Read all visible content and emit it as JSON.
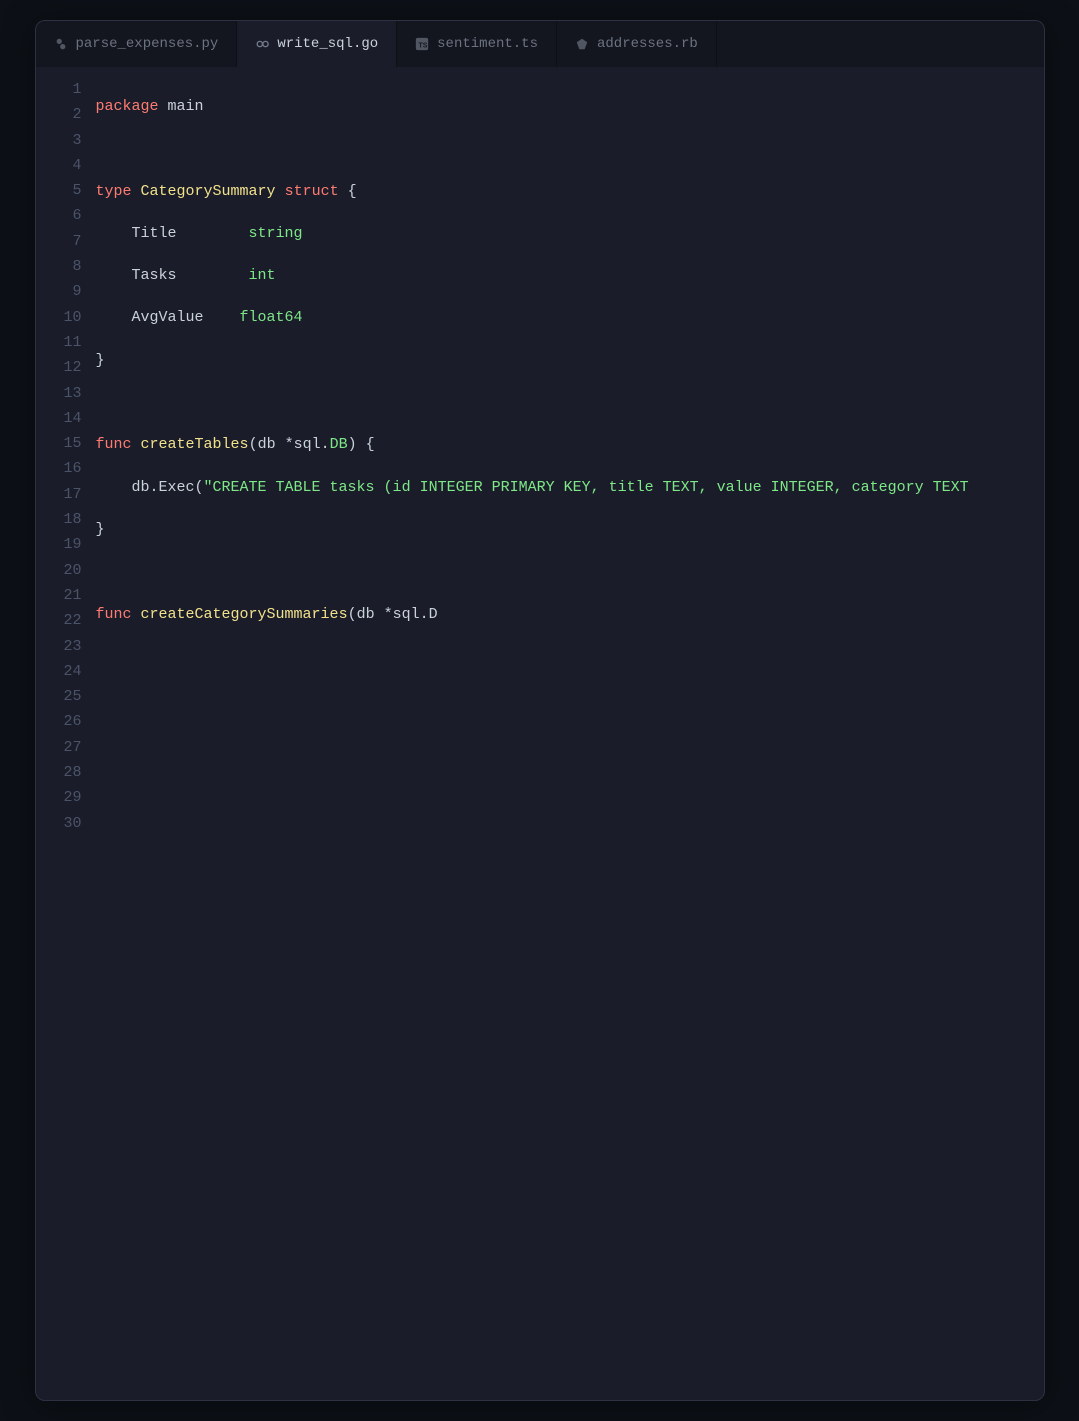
{
  "tabs": [
    {
      "icon": "python-icon",
      "label": "parse_expenses.py",
      "active": false
    },
    {
      "icon": "go-icon",
      "label": "write_sql.go",
      "active": true
    },
    {
      "icon": "ts-icon",
      "label": "sentiment.ts",
      "active": false
    },
    {
      "icon": "ruby-icon",
      "label": "addresses.rb",
      "active": false
    }
  ],
  "gutter": {
    "start": 1,
    "end": 30
  },
  "code": {
    "l1_kw": "package",
    "l1_id": "main",
    "l3_kw": "type",
    "l3_name": "CategorySummary",
    "l3_struct": "struct",
    "l3_brace": "{",
    "l4_field": "    Title        ",
    "l4_type": "string",
    "l5_field": "    Tasks        ",
    "l5_type": "int",
    "l6_field": "    AvgValue    ",
    "l6_type": "float64",
    "l7_brace": "}",
    "l9_kw": "func",
    "l9_name": "createTables",
    "l9_paren": "(db *sql.",
    "l9_type": "DB",
    "l9_close": ") {",
    "l10_call": "    db.Exec(",
    "l10_str": "\"CREATE TABLE tasks (id INTEGER PRIMARY KEY, title TEXT, value INTEGER, category TEXT",
    "l11_brace": "}",
    "l13_kw": "func",
    "l13_name": "createCategorySummaries",
    "l13_paren": "(db *sql.D"
  }
}
